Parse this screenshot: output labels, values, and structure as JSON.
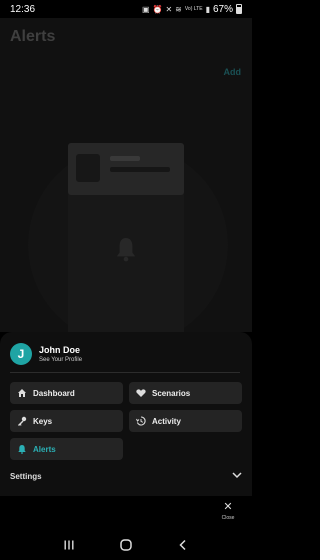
{
  "status": {
    "time": "12:36",
    "signal_text": "Vo) LTE",
    "battery": "67%"
  },
  "page": {
    "title": "Alerts",
    "add_label": "Add"
  },
  "drawer": {
    "profile": {
      "initial": "J",
      "name": "John Doe",
      "subtitle": "See Your Profile"
    },
    "menu": {
      "dashboard": "Dashboard",
      "scenarios": "Scenarios",
      "keys": "Keys",
      "activity": "Activity",
      "alerts": "Alerts"
    },
    "settings_label": "Settings",
    "active_item": "alerts",
    "accent_color": "#2bb0b5"
  },
  "close": {
    "icon": "close-icon",
    "label": "Close"
  },
  "icons": {
    "dashboard": "home-icon",
    "scenarios": "heart-icon",
    "keys": "key-icon",
    "activity": "history-icon",
    "alerts": "bell-icon",
    "settings": "chevron-down-icon",
    "nav": [
      "recents-icon",
      "home-icon",
      "back-icon"
    ]
  }
}
